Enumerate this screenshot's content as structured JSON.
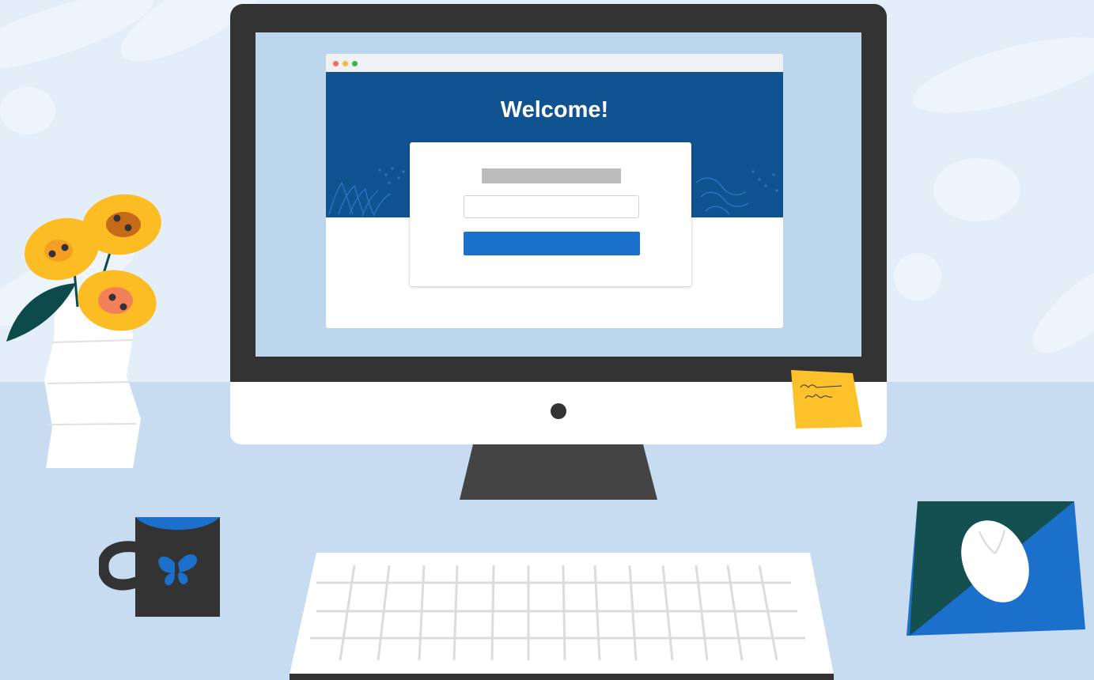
{
  "browser": {
    "title": "Welcome!",
    "traffic_light_colors": [
      "#f26d5b",
      "#f6b93b",
      "#39b54a"
    ]
  },
  "login_card": {
    "label_placeholder_color": "#bcbcbc",
    "input_border_color": "#d2d2d2",
    "button_color": "#1b70cb"
  },
  "colors": {
    "wall": "#e4eef9",
    "desk": "#c7dcf0",
    "monitor_bezel": "#333333",
    "monitor_chin": "#ffffff",
    "screen": "#bcd6ee",
    "hero": "#105391",
    "sticky_note": "#fdc22b",
    "mug": "#333333",
    "mug_rim": "#1b70cb",
    "mousepad_dark": "#145050",
    "mousepad_light": "#1b70cb",
    "flower": "#fbbc24"
  },
  "icons": {
    "mug_logo": "butterfly-icon",
    "mouse": "mouse-icon",
    "camera": "camera-dot-icon"
  }
}
